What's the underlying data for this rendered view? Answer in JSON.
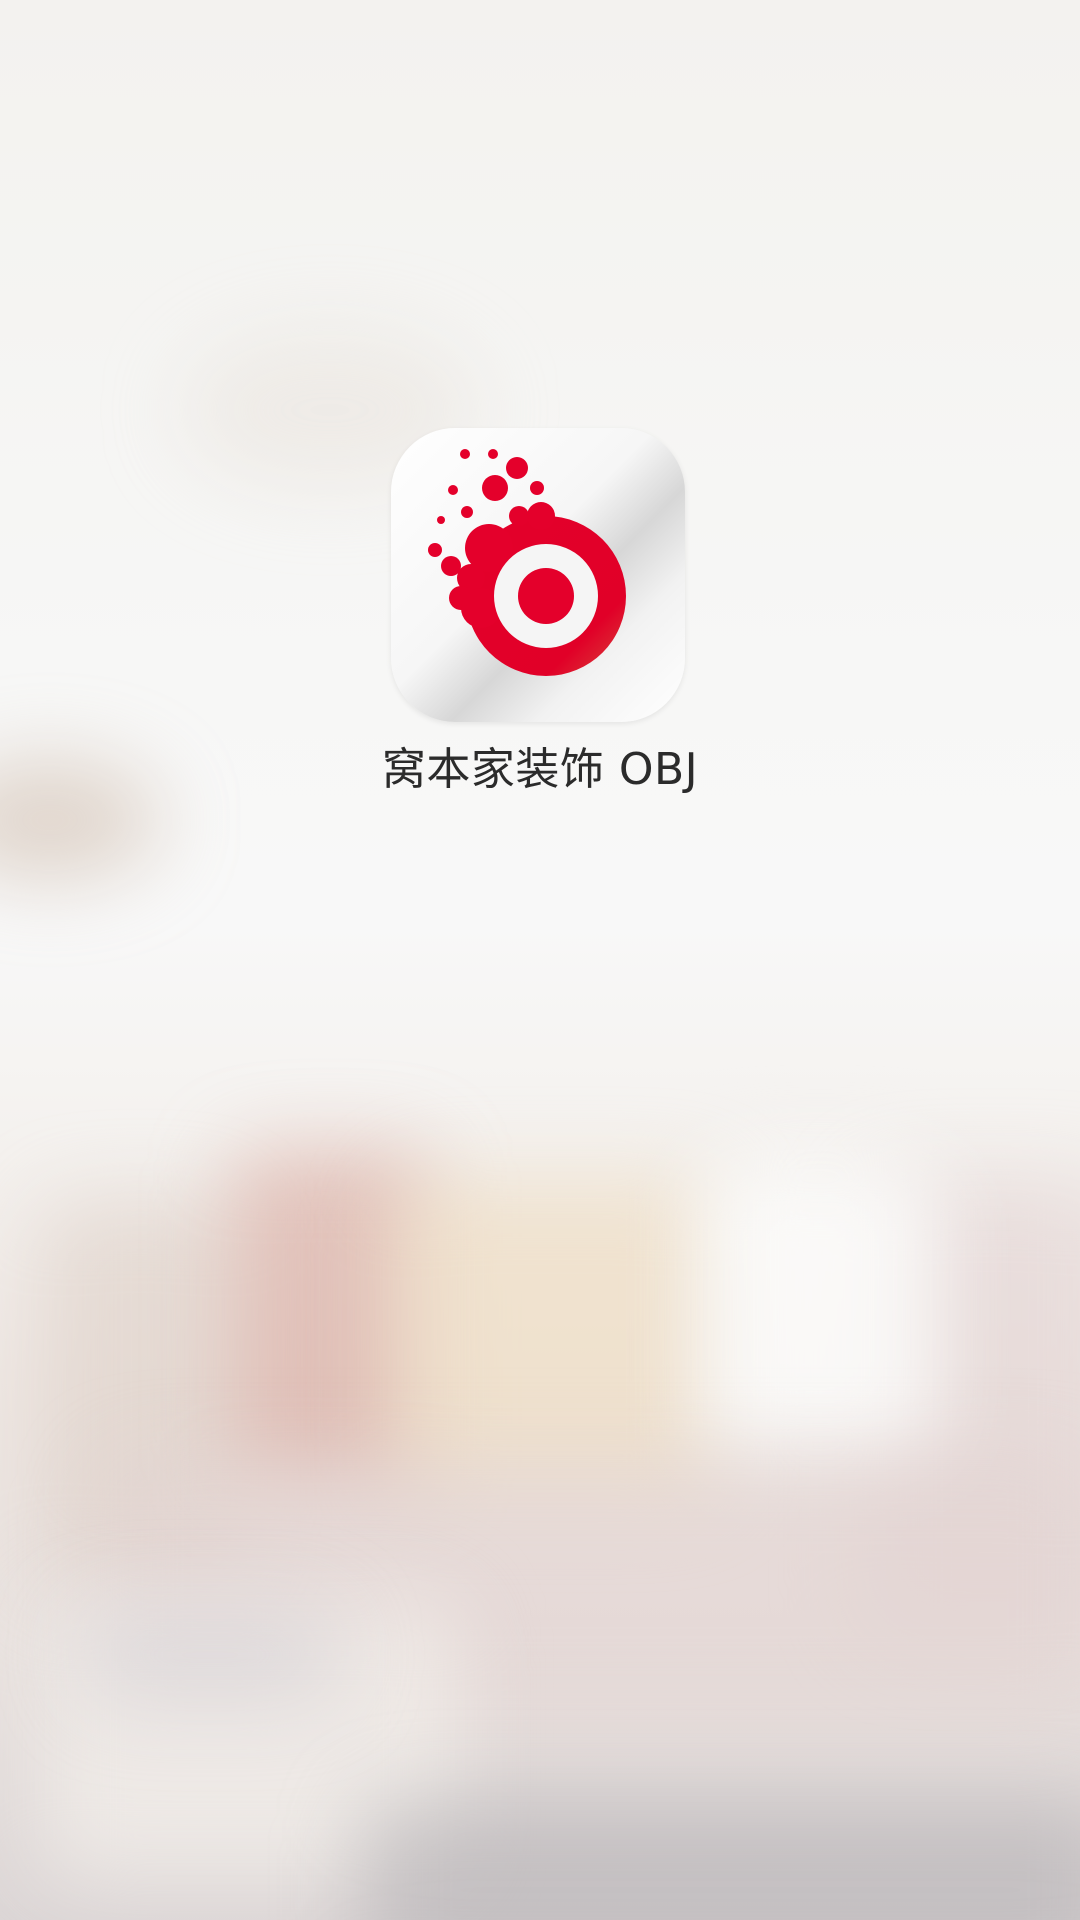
{
  "splash": {
    "app_name": "窝本家装饰 OBJ",
    "logo_icon": "obj-red-target-bubbles-logo"
  },
  "colors": {
    "brand_red": "#e4002b",
    "text": "#2b2b2b",
    "icon_background": "#f4f4f4"
  }
}
